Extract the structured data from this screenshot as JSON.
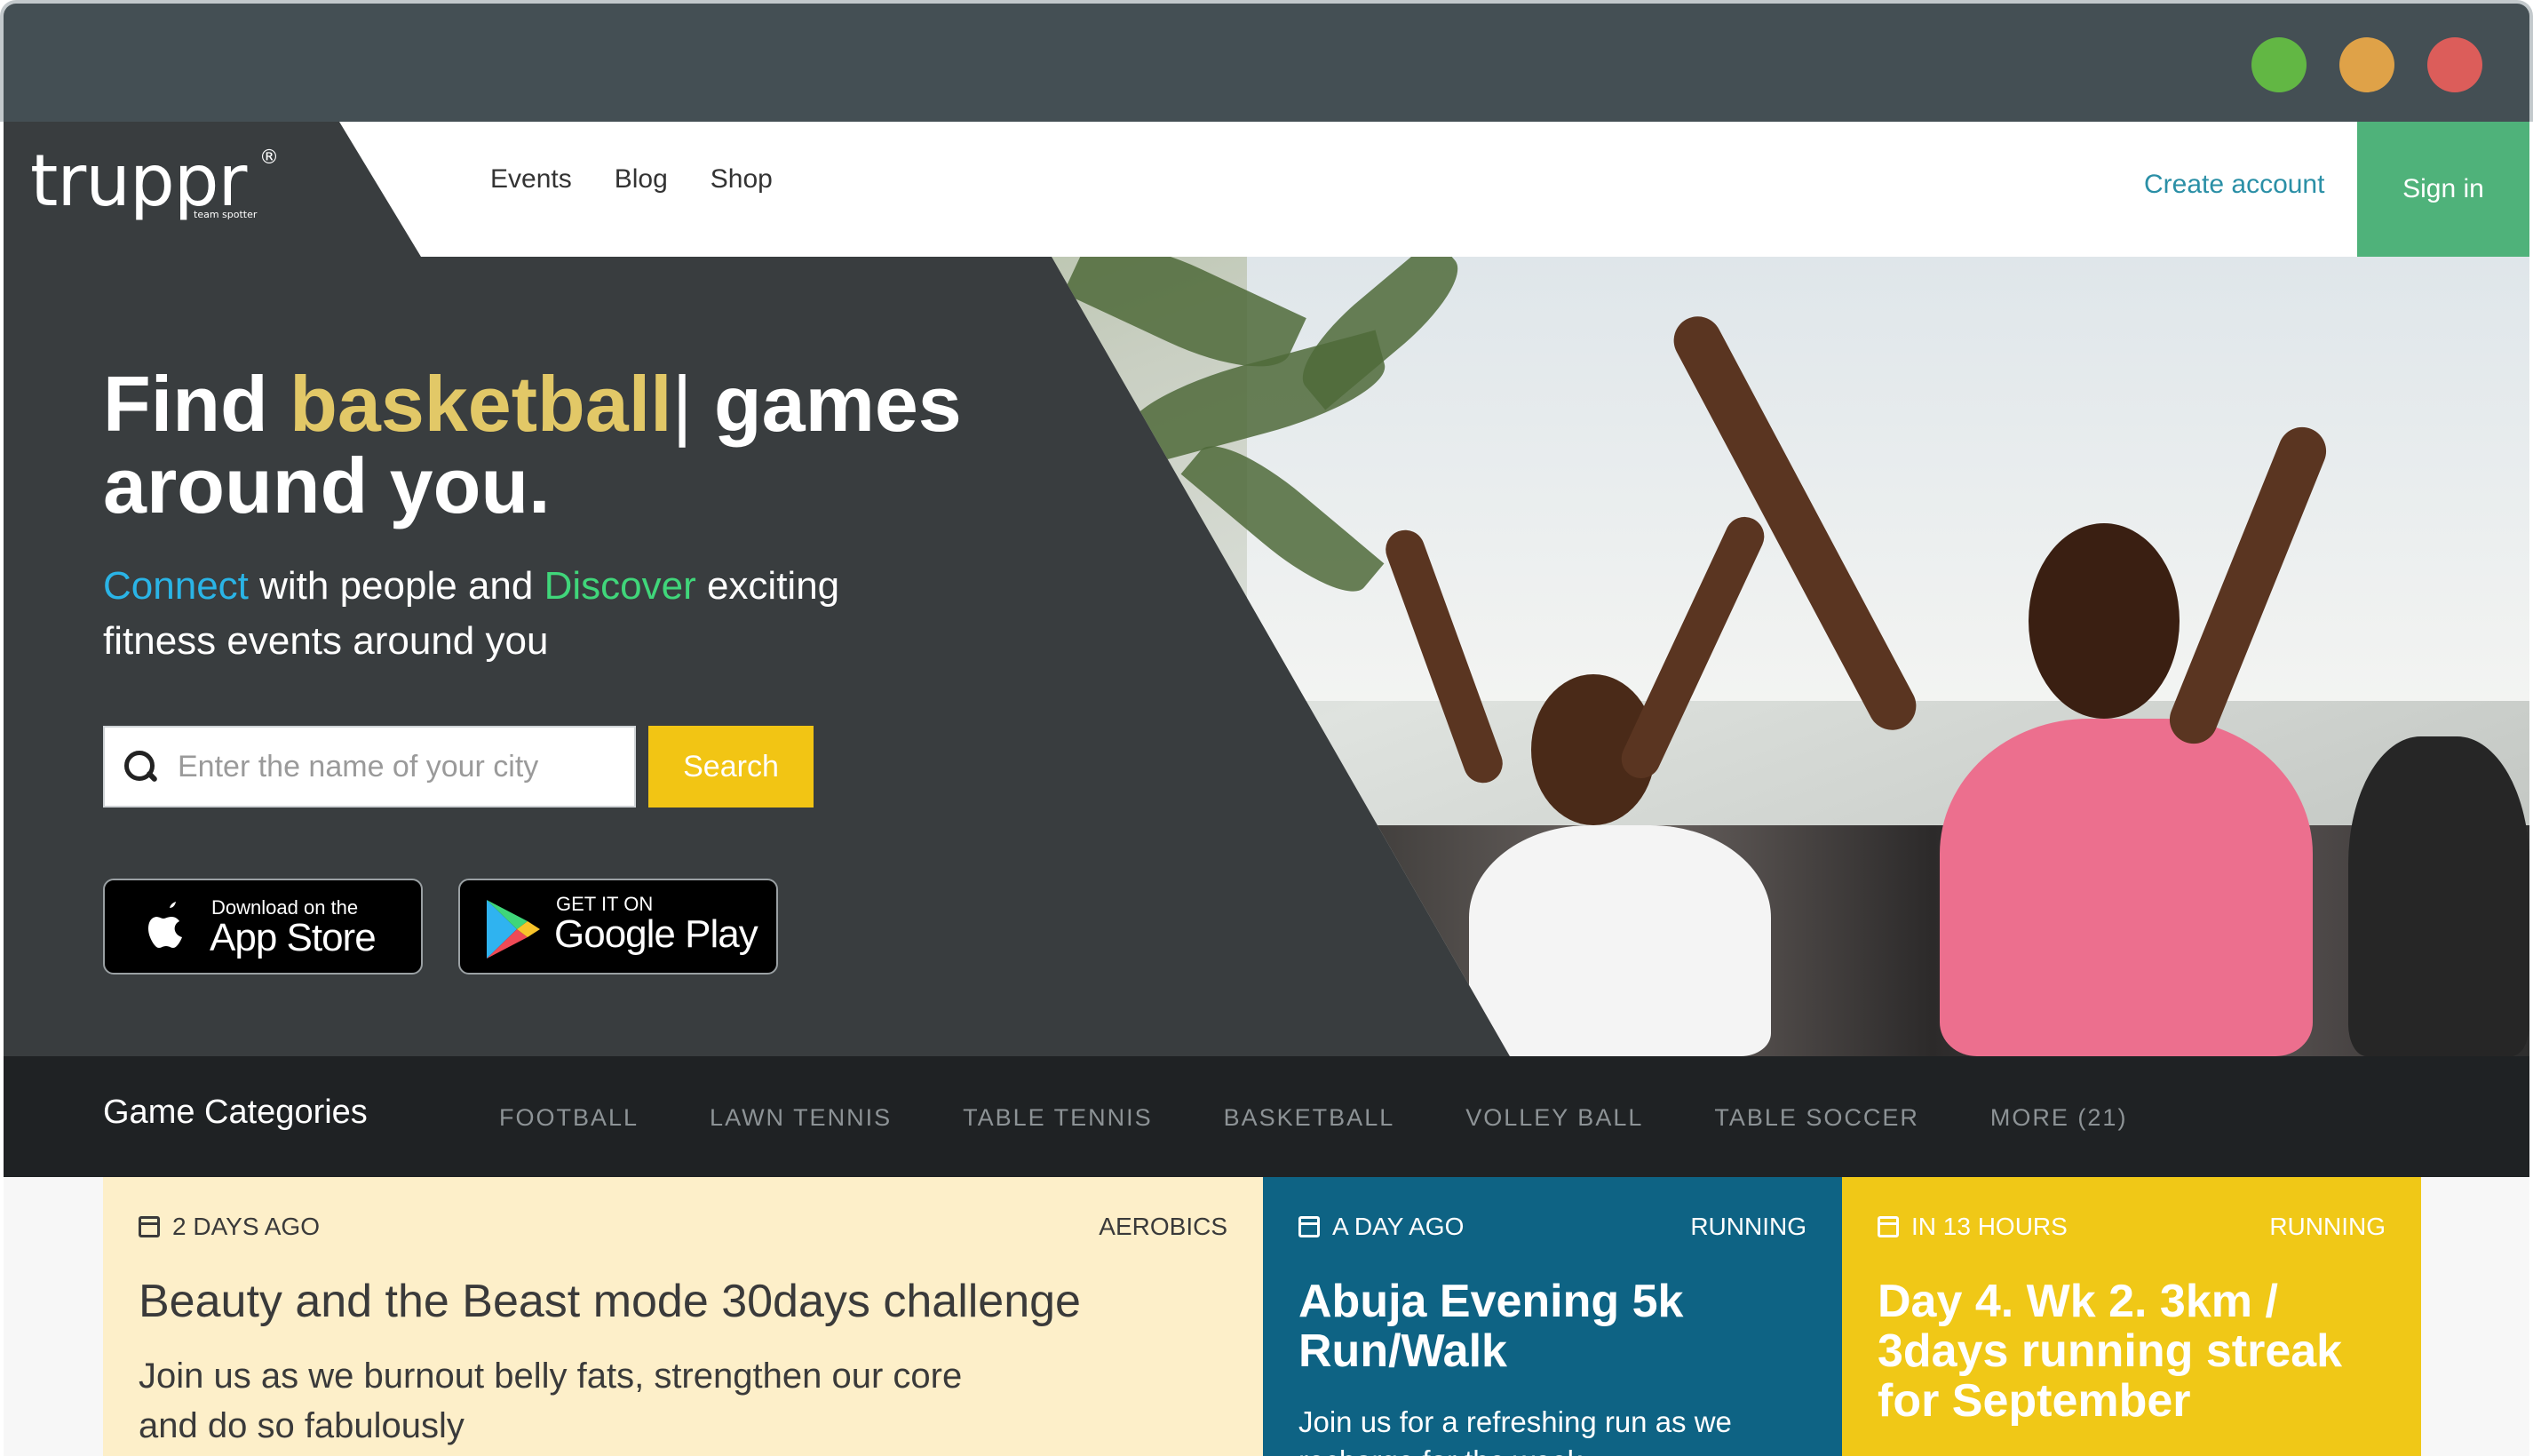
{
  "brand": {
    "name": "truppr",
    "registered": "®",
    "tagline": "team spotter"
  },
  "nav": {
    "links": [
      "Events",
      "Blog",
      "Shop"
    ],
    "create_account": "Create account",
    "sign_in": "Sign in"
  },
  "hero": {
    "headline_pre": "Find ",
    "headline_accent": "basketball",
    "headline_caret": "|",
    "headline_post": " games around you.",
    "sub_connect": "Connect",
    "sub_mid": " with people and ",
    "sub_discover": "Discover",
    "sub_end": " exciting fitness events around you",
    "search_placeholder": "Enter the name of your city",
    "search_button": "Search",
    "appstore_small": "Download on the",
    "appstore_big": "App Store",
    "googleplay_small": "GET IT ON",
    "googleplay_big": "Google Play"
  },
  "categories": {
    "title": "Game Categories",
    "items": [
      "FOOTBALL",
      "LAWN TENNIS",
      "TABLE TENNIS",
      "BASKETBALL",
      "VOLLEY BALL",
      "TABLE SOCCER",
      "MORE (21)"
    ]
  },
  "cards": [
    {
      "time": "2 DAYS AGO",
      "category": "AEROBICS",
      "title": "Beauty and the Beast mode 30days challenge",
      "desc": "Join us as we burnout belly fats, strengthen our core and do so fabulously"
    },
    {
      "time": "A DAY AGO",
      "category": "RUNNING",
      "title": "Abuja Evening 5k Run/Walk",
      "desc": "Join us for a refreshing run as we recharge for the week"
    },
    {
      "time": "IN 13 HOURS",
      "category": "RUNNING",
      "title": "Day 4. Wk 2. 3km / 3days running streak for September",
      "desc": ""
    }
  ],
  "colors": {
    "accent_yellow": "#f2c514",
    "signin_green": "#4fb27a",
    "hero_dark": "#393d3f",
    "card_blue": "#0e6384",
    "card_cream": "#fdefc9"
  }
}
